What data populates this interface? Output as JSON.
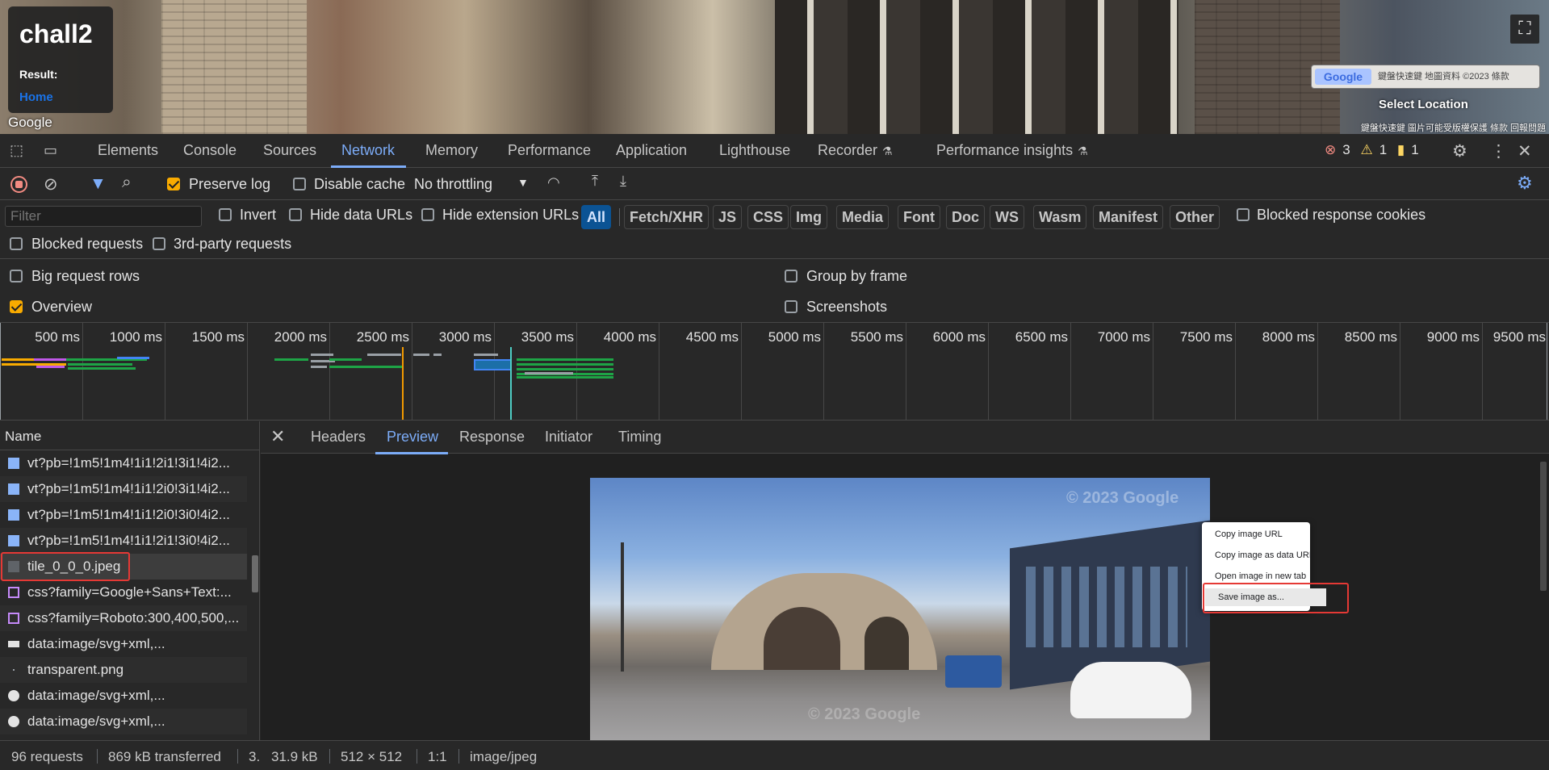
{
  "page": {
    "title": "chall2",
    "result_label": "Result:",
    "home_link": "Home",
    "google_logo": "Google",
    "fullscreen_icon": "fullscreen-icon",
    "minimap_text": "鍵盤快速鍵  地圖資料 ©2023  條款",
    "minimap_logo": "Google",
    "select_location": "Select Location",
    "attribution": "鍵盤快速鍵   圖片可能受版權保護   條款   回報問題"
  },
  "devtools": {
    "tabs": [
      "Elements",
      "Console",
      "Sources",
      "Network",
      "Memory",
      "Performance",
      "Application",
      "Lighthouse",
      "Recorder",
      "Performance insights"
    ],
    "active_tab": "Network",
    "errors": "3",
    "warnings": "1",
    "issues": "1"
  },
  "toolbar": {
    "preserve_log": "Preserve log",
    "disable_cache": "Disable cache",
    "throttling": "No throttling"
  },
  "filter": {
    "placeholder": "Filter",
    "invert": "Invert",
    "hide_data_urls": "Hide data URLs",
    "hide_extension_urls": "Hide extension URLs",
    "types": [
      "All",
      "Fetch/XHR",
      "JS",
      "CSS",
      "Img",
      "Media",
      "Font",
      "Doc",
      "WS",
      "Wasm",
      "Manifest",
      "Other"
    ],
    "blocked_response_cookies": "Blocked response cookies",
    "blocked_requests": "Blocked requests",
    "third_party": "3rd-party requests"
  },
  "settings": {
    "big_request_rows": "Big request rows",
    "group_by_frame": "Group by frame",
    "overview": "Overview",
    "screenshots": "Screenshots"
  },
  "overview": {
    "ticks": [
      "500 ms",
      "1000 ms",
      "1500 ms",
      "2000 ms",
      "2500 ms",
      "3000 ms",
      "3500 ms",
      "4000 ms",
      "4500 ms",
      "5000 ms",
      "5500 ms",
      "6000 ms",
      "6500 ms",
      "7000 ms",
      "7500 ms",
      "8000 ms",
      "8500 ms",
      "9000 ms",
      "9500 ms"
    ]
  },
  "requests": {
    "header": "Name",
    "rows": [
      {
        "name": "vt?pb=!1m5!1m4!1i1!2i1!3i1!4i2...",
        "icon": "image-file-icon"
      },
      {
        "name": "vt?pb=!1m5!1m4!1i1!2i0!3i1!4i2...",
        "icon": "image-file-icon"
      },
      {
        "name": "vt?pb=!1m5!1m4!1i1!2i0!3i0!4i2...",
        "icon": "image-file-icon"
      },
      {
        "name": "vt?pb=!1m5!1m4!1i1!2i1!3i0!4i2...",
        "icon": "image-file-icon"
      },
      {
        "name": "tile_0_0_0.jpeg",
        "icon": "image-file-icon"
      },
      {
        "name": "css?family=Google+Sans+Text:...",
        "icon": "css-file-icon"
      },
      {
        "name": "css?family=Roboto:300,400,500,...",
        "icon": "css-file-icon"
      },
      {
        "name": "data:image/svg+xml,...",
        "icon": "svg-file-icon"
      },
      {
        "name": "transparent.png",
        "icon": "png-file-icon"
      },
      {
        "name": "data:image/svg+xml,...",
        "icon": "svg-file-icon"
      },
      {
        "name": "data:image/svg+xml,...",
        "icon": "svg-file-icon"
      }
    ]
  },
  "detail": {
    "tabs": [
      "Headers",
      "Preview",
      "Response",
      "Initiator",
      "Timing"
    ],
    "active_tab": "Preview",
    "watermark": "© 2023 Google",
    "watermark_bottom": "© 2023 Google"
  },
  "context_menu": {
    "items": [
      "Copy image URL",
      "Copy image as data URI",
      "Open image in new tab",
      "Save image as..."
    ]
  },
  "status": {
    "requests": "96 requests",
    "transferred": "869 kB transferred",
    "resources": "3.",
    "size": "31.9 kB",
    "dimensions": "512 × 512",
    "ratio": "1:1",
    "mime": "image/jpeg"
  },
  "colors": {
    "accent": "#7cacf8",
    "error": "#f28b82",
    "warning": "#fdd663",
    "highlight_box": "#e53935",
    "checkbox_on": "#f9ab00"
  }
}
